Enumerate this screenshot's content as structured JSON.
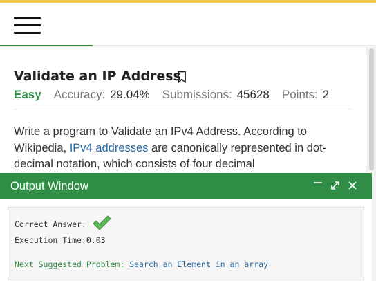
{
  "problem": {
    "title": "Validate an IP Address",
    "difficulty": "Easy",
    "accuracy_label": "Accuracy:",
    "accuracy_value": "29.04%",
    "submissions_label": "Submissions:",
    "submissions_value": "45628",
    "points_label": "Points:",
    "points_value": "2",
    "description": {
      "text_before": "Write a program to Validate an IPv4 Address. According to Wikipedia, ",
      "link_text": "IPv4 addresses",
      "text_after": " are canonically represented in dot-decimal notation, which consists of four decimal"
    }
  },
  "output_window": {
    "title": "Output Window",
    "result": "Correct Answer.",
    "execution_time": "Execution Time:0.03",
    "next_label": "Next Suggested Problem:",
    "next_link": "Search an Element in an array"
  },
  "colors": {
    "accent_green": "#2f8d46",
    "top_bar_yellow": "#f7c948",
    "link_blue": "#2a6aa5",
    "check_green": "#5cb85c"
  },
  "icons": {
    "menu": "hamburger-menu-icon",
    "bookmark": "bookmark-icon",
    "minimize": "minimize-icon",
    "maximize": "expand-icon",
    "close": "close-icon",
    "success": "checkmark-icon"
  }
}
